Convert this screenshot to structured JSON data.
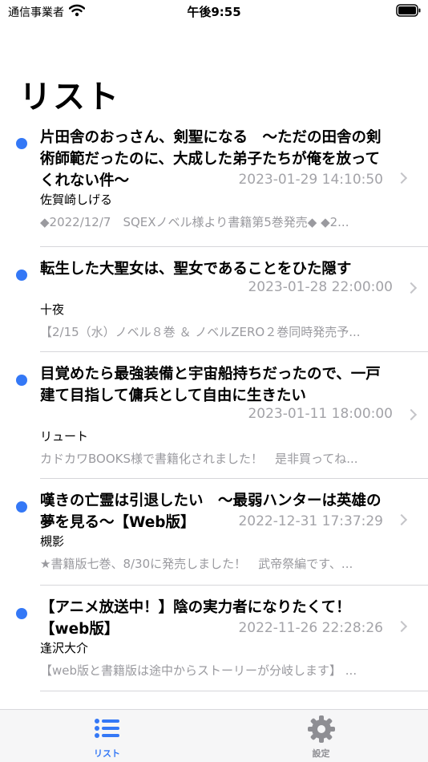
{
  "status_bar": {
    "carrier": "通信事業者",
    "time": "午後9:55"
  },
  "title": "リスト",
  "items": [
    {
      "title_lines": [
        "片田舎のおっさん、剣聖になる　～ただの田舎の剣",
        "術師範だったのに、大成した弟子たちが俺を放って",
        "くれない件～"
      ],
      "date": "2023-01-29 14:10:50",
      "author": "佐賀崎しげる",
      "snippet": "◆2022/12/7　SQEXノベル様より書籍第5巻発売◆ ◆2...",
      "unread": true
    },
    {
      "title_lines": [
        "転生した大聖女は、聖女であることをひた隠す"
      ],
      "date": "2023-01-28 22:00:00",
      "author": "十夜",
      "snippet": "【2/15（水）ノベル８巻 ＆ ノベルZERO２巻同時発売予...",
      "unread": true
    },
    {
      "title_lines": [
        "目覚めたら最強装備と宇宙船持ちだったので、一戸",
        "建て目指して傭兵として自由に生きたい"
      ],
      "date": "2023-01-11 18:00:00",
      "author": "リュート",
      "snippet": "カドカワBOOKS様で書籍化されました！　是非買ってね...",
      "unread": true
    },
    {
      "title_lines": [
        "嘆きの亡霊は引退したい　～最弱ハンターは英雄の",
        "夢を見る～【Web版】"
      ],
      "date": "2022-12-31 17:37:29",
      "author": "槻影",
      "snippet": "★書籍版七巻、8/30に発売しました！　武帝祭編です、...",
      "unread": true
    },
    {
      "title_lines": [
        "【アニメ放送中！】陰の実力者になりたくて！",
        "【web版】"
      ],
      "date": "2022-11-26 22:28:26",
      "author": "逢沢大介",
      "snippet": "【web版と書籍版は途中からストーリーが分岐します】 ...",
      "unread": true
    }
  ],
  "tabs": [
    {
      "label": "リスト",
      "icon": "list-icon",
      "active": true,
      "color": "#3478f6"
    },
    {
      "label": "設定",
      "icon": "gear-icon",
      "active": false,
      "color": "#8e8e93"
    }
  ],
  "colors": {
    "accent": "#3478f6",
    "secondary_text": "#a3a3a8",
    "separator": "#d6d6da"
  }
}
